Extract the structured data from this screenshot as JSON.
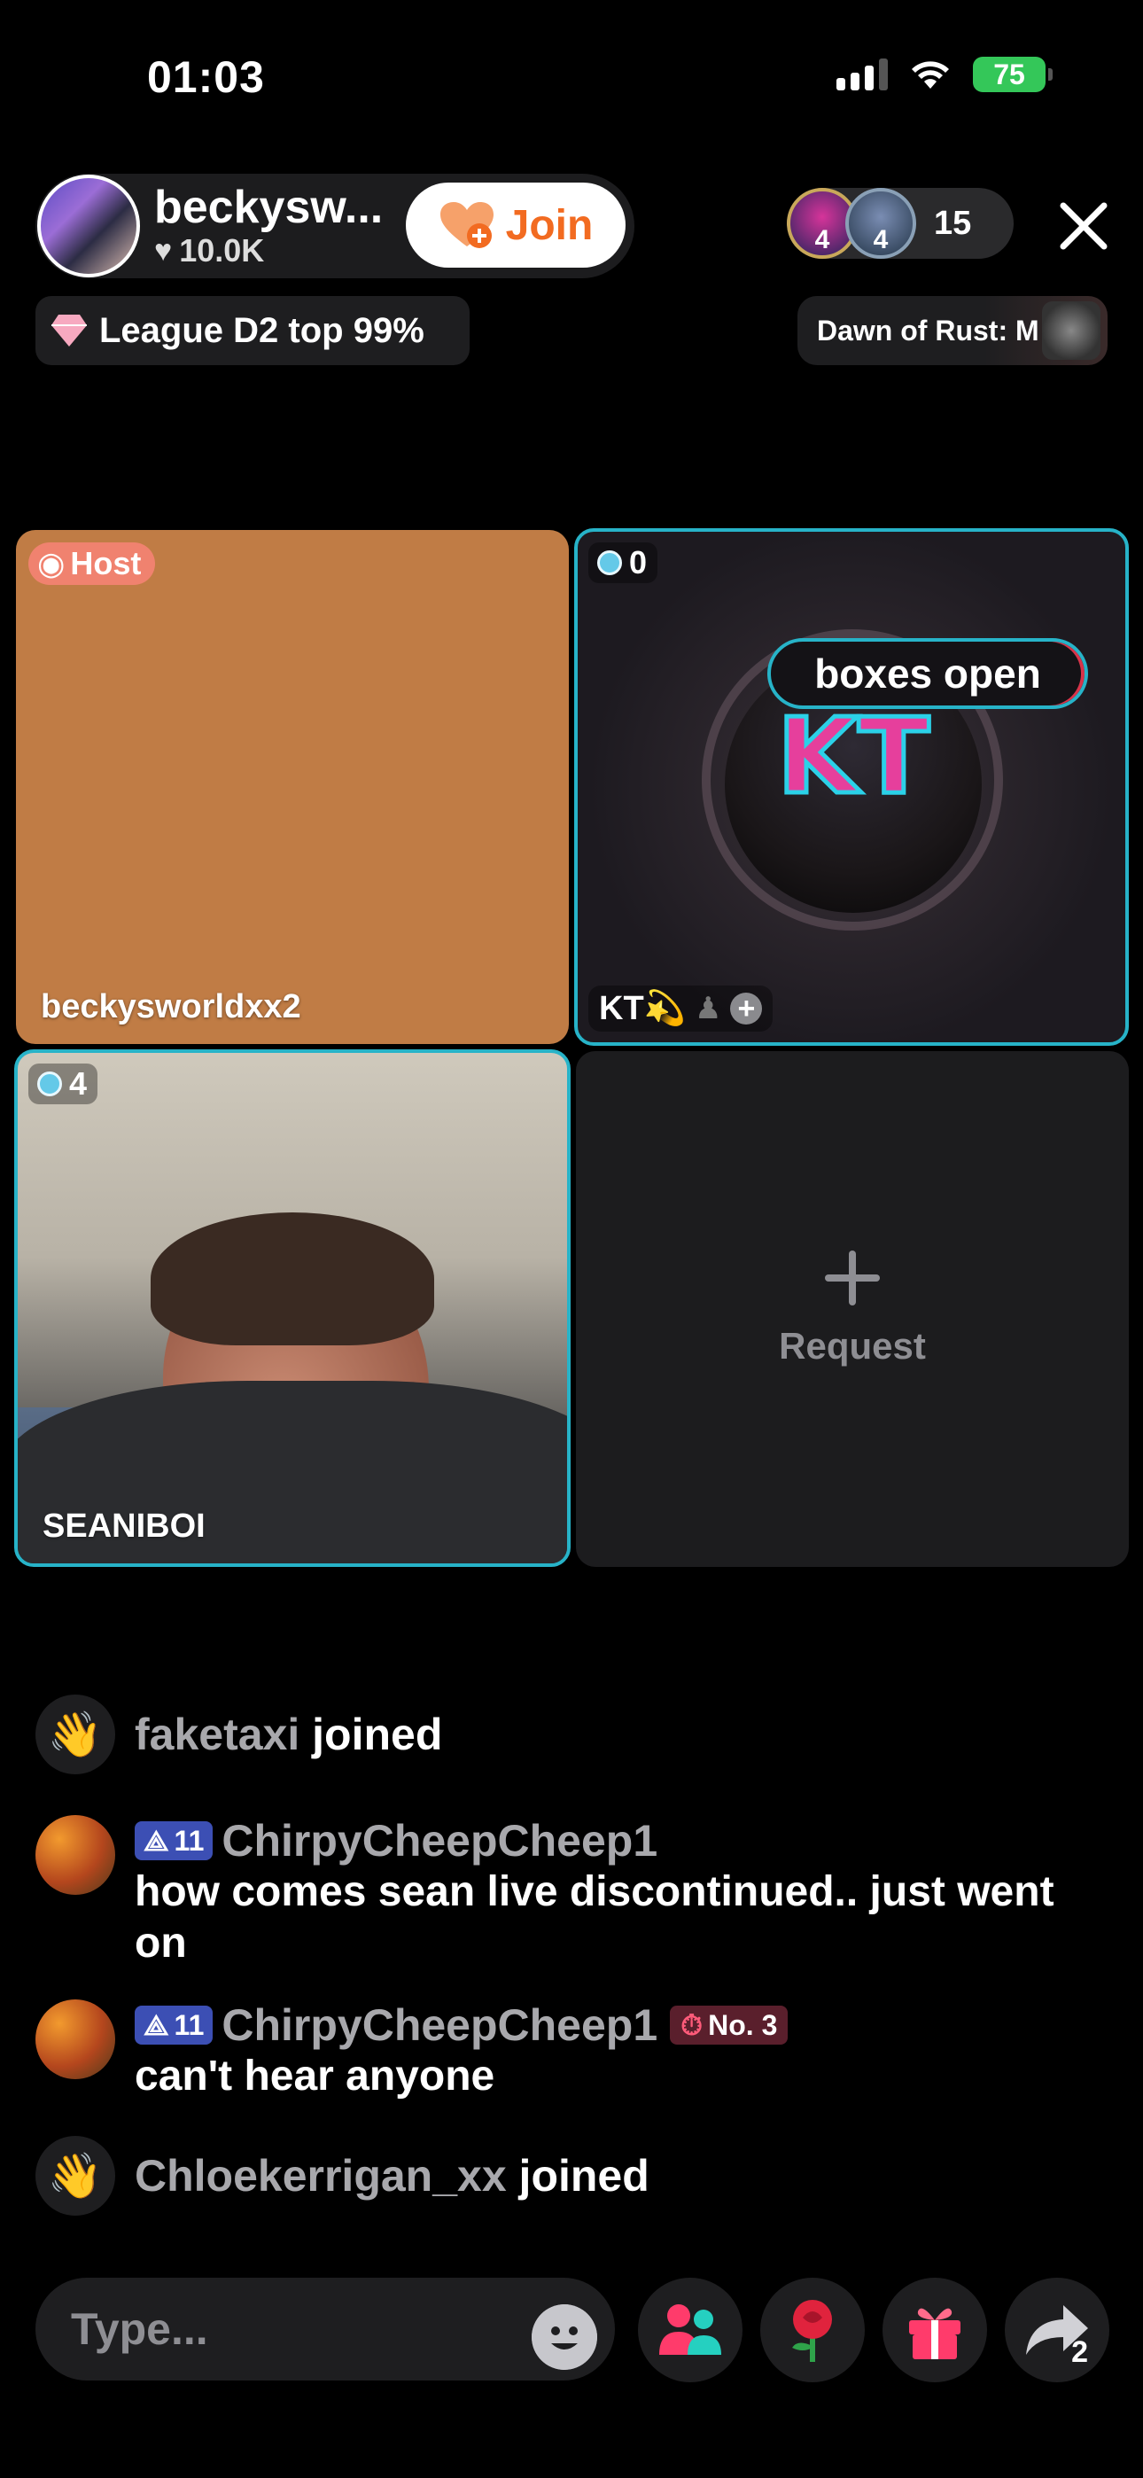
{
  "status_bar": {
    "time": "01:03",
    "battery": "75"
  },
  "header": {
    "host_name": "beckysw...",
    "host_likes": "10.0K",
    "join_label": "Join",
    "viewer_badges": [
      "4",
      "4"
    ],
    "viewer_count": "15",
    "league_label": "League D2 top 99%",
    "event_label": "Dawn of Rust: M"
  },
  "grid": {
    "host_tile": {
      "badge": "Host",
      "name": "beckysworldxx2"
    },
    "kt_tile": {
      "score": "0",
      "pill_text": "boxes open",
      "name": "KT💫",
      "logo_text": "KT"
    },
    "sean_tile": {
      "score": "4",
      "name": "SEANIBOI"
    },
    "request_tile": {
      "label": "Request"
    }
  },
  "chat": [
    {
      "type": "join",
      "user": "faketaxi",
      "suffix": "joined"
    },
    {
      "type": "message",
      "level": "11",
      "user": "ChirpyCheepCheep1",
      "text": "how comes sean live discontinued.. just went on"
    },
    {
      "type": "message",
      "level": "11",
      "user": "ChirpyCheepCheep1",
      "rank": "No. 3",
      "text": "can't hear anyone"
    },
    {
      "type": "join",
      "user": "Chloekerrigan_xx",
      "suffix": "joined"
    }
  ],
  "bottom_bar": {
    "input_placeholder": "Type...",
    "share_count": "2"
  },
  "colors": {
    "accent_cyan": "#27b3c8",
    "host_tile": "#c07c45",
    "join_orange": "#f26b21",
    "battery_green": "#34c759"
  },
  "icons": [
    "signal-icon",
    "wifi-icon",
    "battery-icon",
    "heart-icon",
    "close-icon",
    "diamond-icon",
    "wave-icon",
    "emoji-icon",
    "guests-icon",
    "rose-icon",
    "gift-icon",
    "share-icon"
  ]
}
